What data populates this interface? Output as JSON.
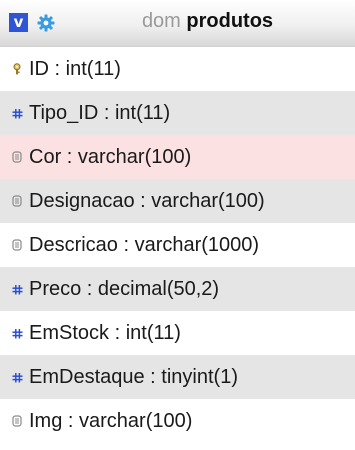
{
  "header": {
    "toggle_label": "v",
    "db_name": "dom",
    "table_name": "produtos"
  },
  "columns": [
    {
      "label": "ID : int(11)",
      "icon": "key-icon",
      "highlighted": false
    },
    {
      "label": "Tipo_ID : int(11)",
      "icon": "numeric-icon",
      "highlighted": false
    },
    {
      "label": "Cor : varchar(100)",
      "icon": "text-icon",
      "highlighted": true
    },
    {
      "label": "Designacao : varchar(100)",
      "icon": "text-icon",
      "highlighted": false
    },
    {
      "label": "Descricao : varchar(1000)",
      "icon": "text-icon",
      "highlighted": false
    },
    {
      "label": "Preco : decimal(50,2)",
      "icon": "numeric-icon",
      "highlighted": false
    },
    {
      "label": "EmStock : int(11)",
      "icon": "numeric-icon",
      "highlighted": false
    },
    {
      "label": "EmDestaque : tinyint(1)",
      "icon": "numeric-icon",
      "highlighted": false
    },
    {
      "label": "Img : varchar(100)",
      "icon": "text-icon",
      "highlighted": false
    }
  ],
  "colors": {
    "toggle_bg": "#2f55d4",
    "settings_icon": "#3a9be0",
    "numeric_icon": "#2a50d0",
    "key_icon": "#b08a28",
    "text_icon": "#8a8a8a",
    "highlight_row": "#fbe1e1",
    "alt_row": "#e5e5e5"
  }
}
